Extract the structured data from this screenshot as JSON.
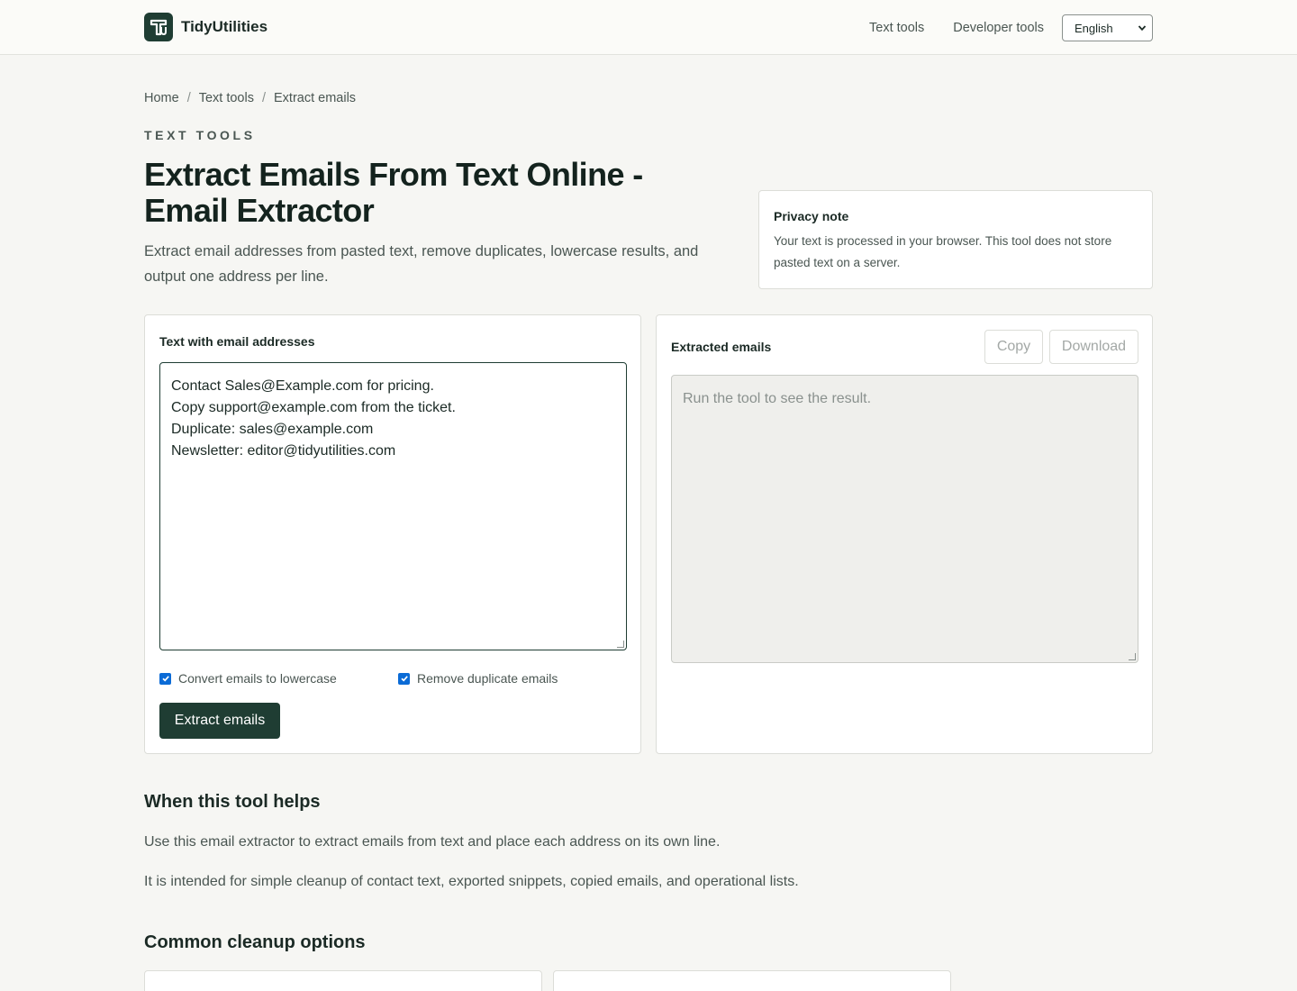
{
  "header": {
    "brand_name": "TidyUtilities",
    "nav": [
      "Text tools",
      "Developer tools"
    ],
    "language": "English"
  },
  "breadcrumb": [
    "Home",
    "Text tools",
    "Extract emails"
  ],
  "hero": {
    "eyebrow": "TEXT TOOLS",
    "title": "Extract Emails From Text Online - Email Extractor",
    "description": "Extract email addresses from pasted text, remove duplicates, lowercase results, and output one address per line."
  },
  "privacy": {
    "title": "Privacy note",
    "body": "Your text is processed in your browser. This tool does not store pasted text on a server."
  },
  "input_panel": {
    "label": "Text with email addresses",
    "lines": [
      "Contact Sales@Example.com for pricing.",
      "Copy support@example.com from the ticket.",
      "Duplicate: sales@example.com",
      "Newsletter: editor@tidyutilities.com"
    ],
    "options": [
      {
        "label": "Convert emails to lowercase",
        "checked": true
      },
      {
        "label": "Remove duplicate emails",
        "checked": true
      }
    ],
    "submit_label": "Extract emails"
  },
  "output_panel": {
    "label": "Extracted emails",
    "copy_label": "Copy",
    "download_label": "Download",
    "placeholder": "Run the tool to see the result."
  },
  "sections": {
    "helps_title": "When this tool helps",
    "helps_paragraphs": [
      "Use this email extractor to extract emails from text and place each address on its own line.",
      "It is intended for simple cleanup of contact text, exported snippets, copied emails, and operational lists."
    ],
    "options_title": "Common cleanup options"
  },
  "colors": {
    "brand": "#1f3d33",
    "checkbox": "#0b6bd6",
    "background": "#f6f6f3"
  }
}
